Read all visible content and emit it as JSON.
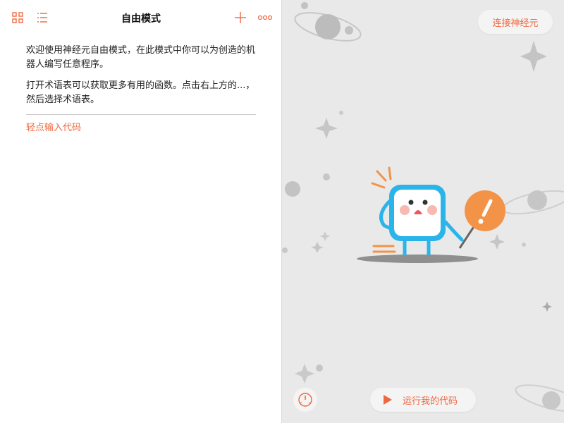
{
  "editor": {
    "title": "自由模式",
    "paragraphs": [
      "欢迎使用神经元自由模式，在此模式中你可以为创造的机器人编写任意程序。",
      "打开术语表可以获取更多有用的函数。点击右上方的...，然后选择术语表。"
    ],
    "placeholder": "轻点输入代码"
  },
  "live_view": {
    "connect_label": "连接神经元",
    "run_label": "运行我的代码"
  },
  "colors": {
    "accent": "#f0673f",
    "robot": "#2bb4ea",
    "sign": "#f39347",
    "space_bg": "#e9e9e9"
  },
  "icons": {
    "toolbar_left": [
      "grid-icon",
      "list-icon"
    ],
    "toolbar_right": [
      "plus-icon",
      "more-icon"
    ],
    "run": "play-icon",
    "speed": "speedometer-icon"
  }
}
